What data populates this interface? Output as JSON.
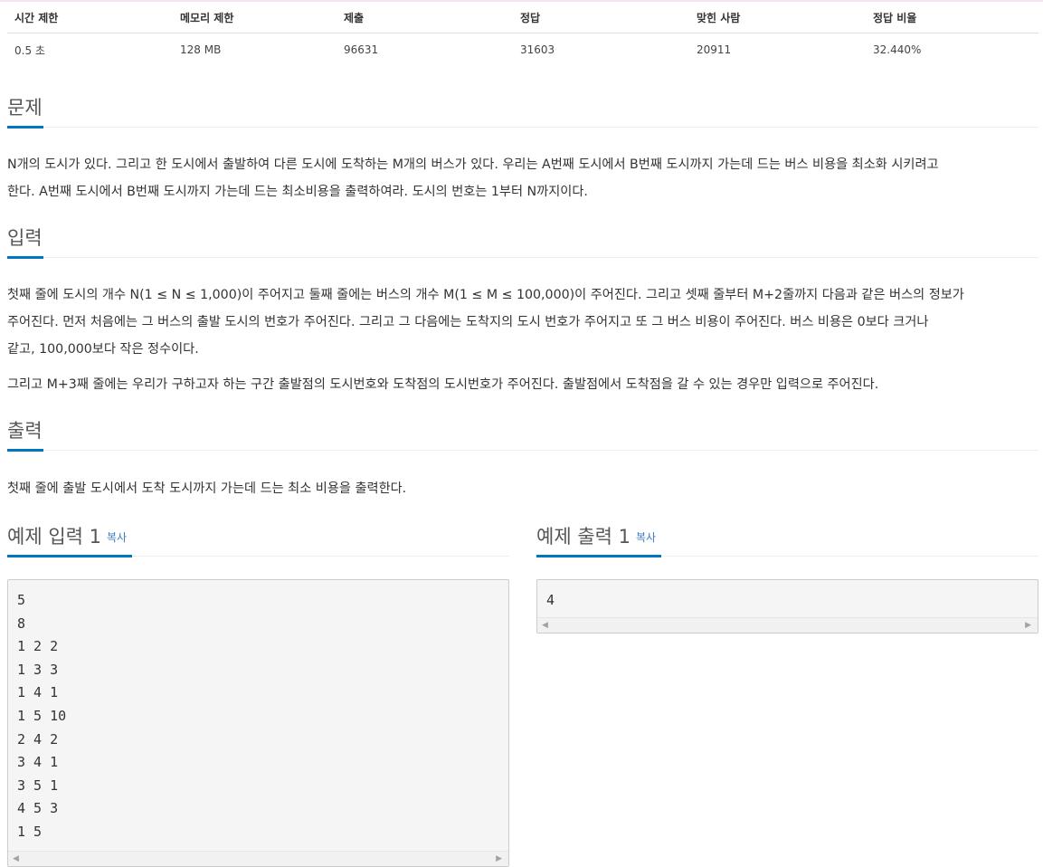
{
  "stats": {
    "headers": [
      "시간 제한",
      "메모리 제한",
      "제출",
      "정답",
      "맞힌 사람",
      "정답 비율"
    ],
    "values": [
      "0.5 초",
      "128 MB",
      "96631",
      "31603",
      "20911",
      "32.440%"
    ]
  },
  "problem": {
    "title": "문제",
    "lines": [
      "N개의 도시가 있다. 그리고 한 도시에서 출발하여 다른 도시에 도착하는 M개의 버스가 있다. 우리는 A번째 도시에서 B번째 도시까지 가는데 드는 버스 비용을 최소화 시키려고",
      "한다. A번째 도시에서 B번째 도시까지 가는데 드는 최소비용을 출력하여라. 도시의 번호는 1부터 N까지이다."
    ]
  },
  "input": {
    "title": "입력",
    "lines": [
      "첫째 줄에 도시의 개수 N(1 ≤ N ≤ 1,000)이 주어지고 둘째 줄에는 버스의 개수 M(1 ≤ M ≤ 100,000)이 주어진다. 그리고 셋째 줄부터 M+2줄까지 다음과 같은 버스의 정보가",
      "주어진다. 먼저 처음에는 그 버스의 출발 도시의 번호가 주어진다. 그리고 그 다음에는 도착지의 도시 번호가 주어지고 또 그 버스 비용이 주어진다. 버스 비용은 0보다 크거나",
      "같고, 100,000보다 작은 정수이다."
    ],
    "second_paragraph": "그리고 M+3째 줄에는 우리가 구하고자 하는 구간 출발점의 도시번호와 도착점의 도시번호가 주어진다. 출발점에서 도착점을 갈 수 있는 경우만 입력으로 주어진다."
  },
  "output": {
    "title": "출력",
    "line": "첫째 줄에 출발 도시에서 도착 도시까지 가는데 드는 최소 비용을 출력한다."
  },
  "sample_input": {
    "title": "예제 입력 1",
    "copy_label": "복사",
    "content": "5\n8\n1 2 2\n1 3 3\n1 4 1\n1 5 10\n2 4 2\n3 4 1\n3 5 1\n4 5 3\n1 5"
  },
  "sample_output": {
    "title": "예제 출력 1",
    "copy_label": "복사",
    "content": "4"
  },
  "icons": {
    "scroll_left": "scroll-left-arrow-icon",
    "scroll_right": "scroll-right-arrow-icon"
  },
  "colors": {
    "accent_underline": "#0076c0",
    "copy_link": "#3b7bbf",
    "sample_bg": "#f5f5f5"
  }
}
